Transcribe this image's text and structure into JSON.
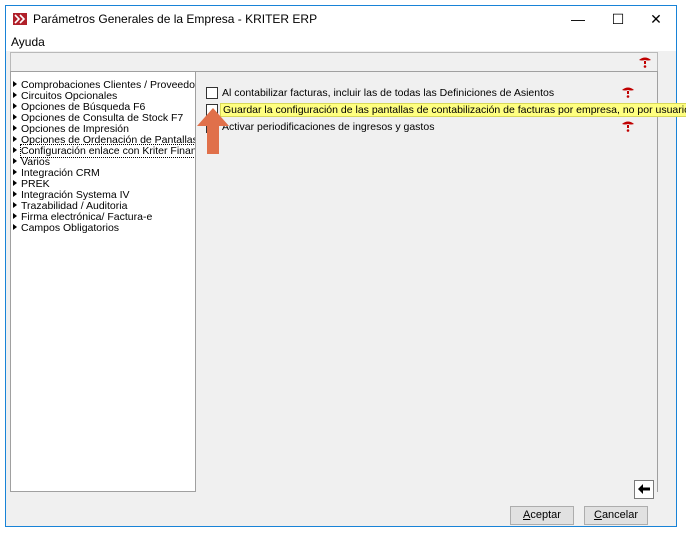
{
  "window": {
    "title": "Parámetros Generales de la Empresa - KRITER ERP",
    "minimize": "—",
    "maximize": "☐",
    "close": "✕"
  },
  "menu": {
    "help": "Ayuda"
  },
  "tree": {
    "items": [
      {
        "label": "Comprobaciones Clientes / Proveedores"
      },
      {
        "label": "Circuitos Opcionales"
      },
      {
        "label": "Opciones de Búsqueda F6"
      },
      {
        "label": "Opciones de Consulta de Stock F7"
      },
      {
        "label": "Opciones de Impresión"
      },
      {
        "label": "Opciones de Ordenación de Pantallas"
      },
      {
        "label": "Configuración enlace con Kriter Finances",
        "selected": true
      },
      {
        "label": "Varios"
      },
      {
        "label": "Integración CRM"
      },
      {
        "label": "PREK"
      },
      {
        "label": "Integración Systema IV"
      },
      {
        "label": "Trazabilidad / Auditoria"
      },
      {
        "label": "Firma electrónica/ Factura-e"
      },
      {
        "label": "Campos Obligatorios"
      }
    ]
  },
  "options": [
    {
      "label": "Al contabilizar facturas, incluir las de todas las Definiciones de Asientos",
      "checked": false
    },
    {
      "label": "Guardar la configuración de las pantallas de contabilización de facturas por empresa, no por usuario",
      "checked": false
    },
    {
      "label": "Activar periodificaciones de ingresos y gastos",
      "checked": false
    }
  ],
  "buttons": {
    "accept_u": "A",
    "accept_rest": "ceptar",
    "cancel_u": "C",
    "cancel_rest": "ancelar",
    "back": "🡸"
  },
  "colors": {
    "highlight": "#ffff80",
    "arrow": "#e0704a",
    "help_icon": "#c00000"
  }
}
